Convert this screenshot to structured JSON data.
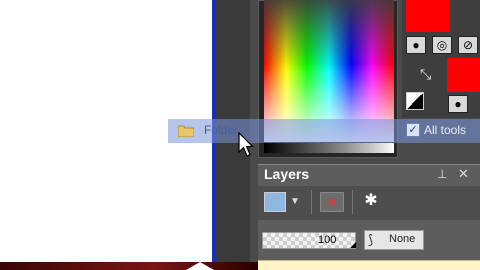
{
  "drag": {
    "folder_label": "Folder"
  },
  "options": {
    "all_tools_label": "All tools",
    "all_tools_checked": "✓"
  },
  "layers": {
    "title": "Layers",
    "opacity_value": "100",
    "blend_mode": "None"
  },
  "colors": {
    "foreground": "#ff0000",
    "background": "#ff0000",
    "panel": "#4a4a4a",
    "drag_highlight": "#7896dc"
  },
  "icons": {
    "pin": "pin-icon",
    "close": "close-icon",
    "new_layer": "new-layer-icon",
    "delete_layer": "delete-layer-icon",
    "effects": "layer-effects-icon",
    "swap": "swap-colors-icon",
    "default_colors": "default-colors-icon",
    "folder": "folder-icon",
    "cursor": "mouse-cursor-icon"
  }
}
